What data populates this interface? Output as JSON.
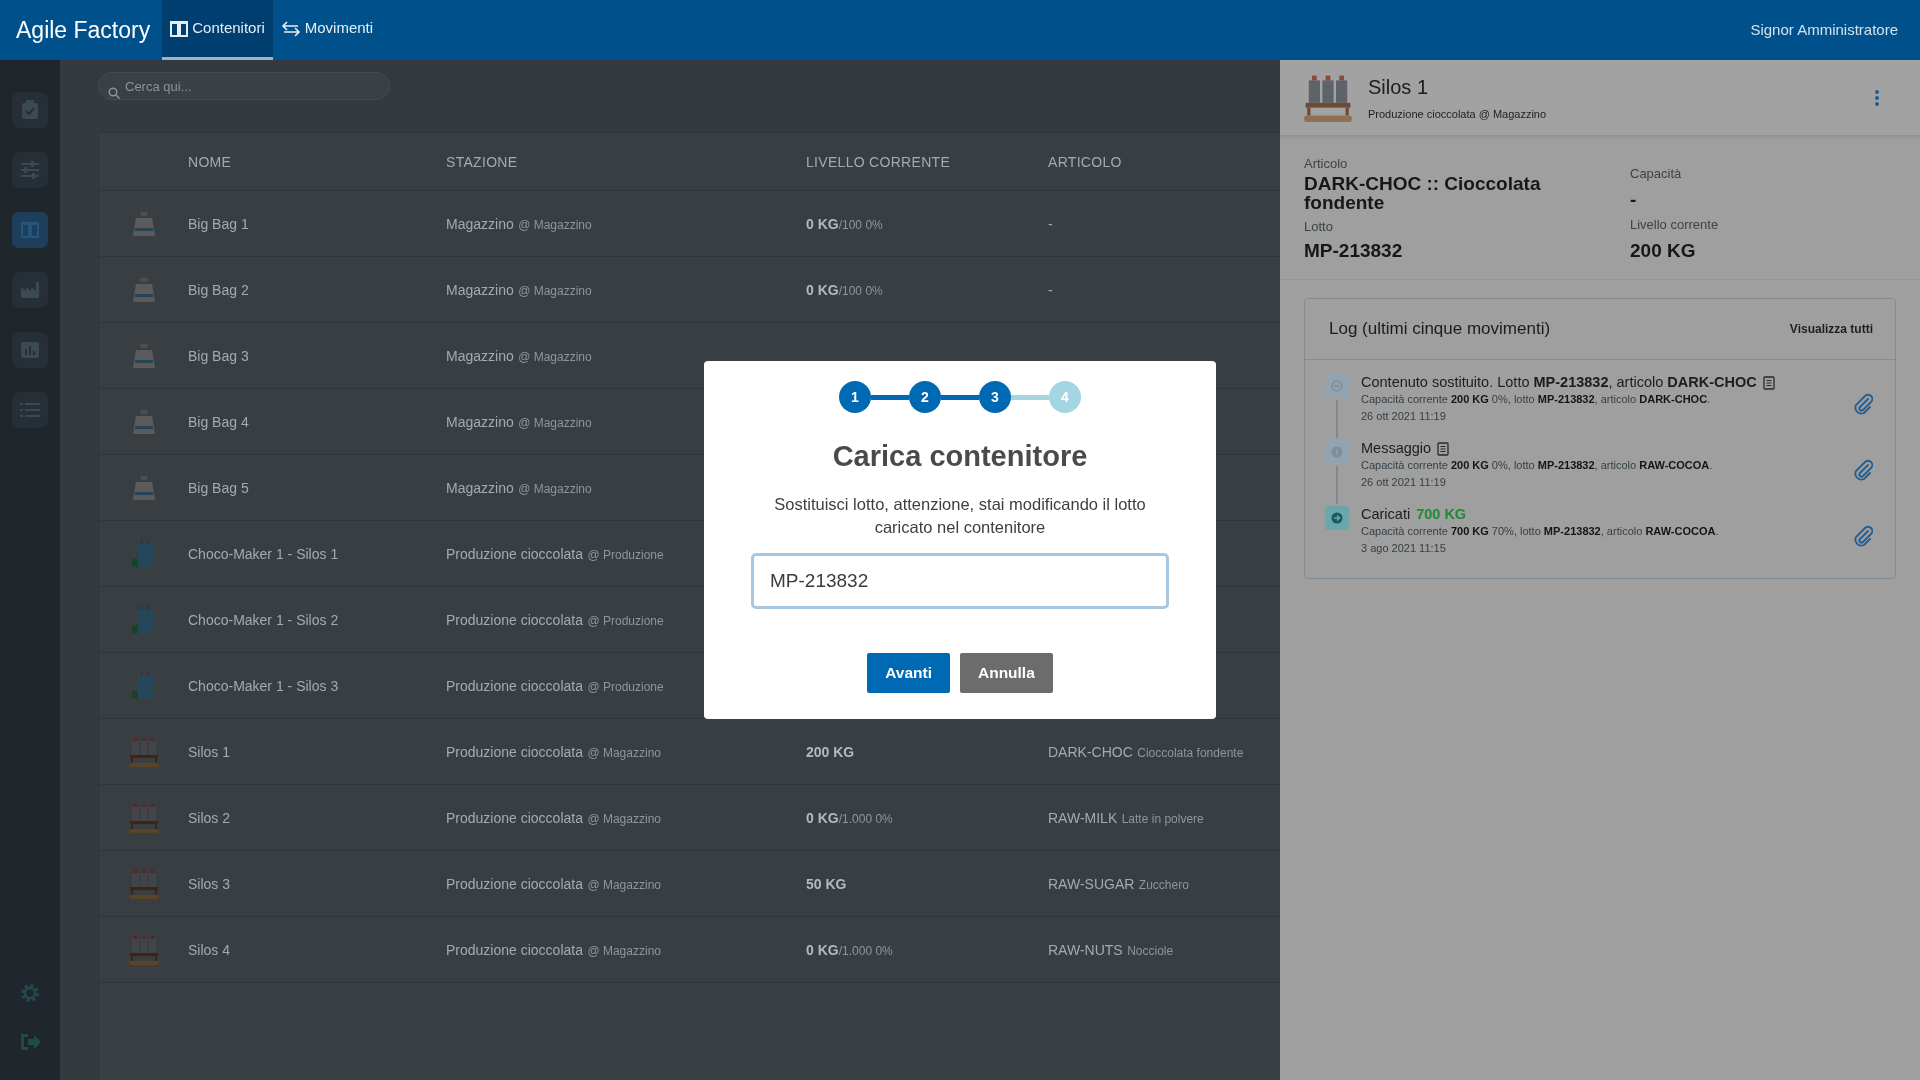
{
  "app": {
    "title": "Agile Factory",
    "user": "Signor Amministratore"
  },
  "nav_tabs": [
    {
      "label": "Contenitori",
      "kind": "containers",
      "selected": true
    },
    {
      "label": "Movimenti",
      "kind": "transfers",
      "selected": false
    }
  ],
  "sidebar": {
    "items": [
      {
        "kind": "tasks",
        "selected": false
      },
      {
        "kind": "flows",
        "selected": false
      },
      {
        "kind": "containers",
        "selected": true
      },
      {
        "kind": "factory",
        "selected": false
      },
      {
        "kind": "chart",
        "selected": false
      },
      {
        "kind": "list",
        "selected": false
      }
    ]
  },
  "search": {
    "placeholder": "Cerca qui..."
  },
  "table": {
    "columns": [
      "NOME",
      "STAZIONE",
      "LIVELLO CORRENTE",
      "ARTICOLO"
    ],
    "rows": [
      {
        "kind": "bigbag",
        "name": "Big Bag 1",
        "station": "Magazzino",
        "location": "@ Magazzino",
        "reading": "**0 KG**/100 0%",
        "article_code": "-"
      },
      {
        "kind": "bigbag",
        "name": "Big Bag 2",
        "station": "Magazzino",
        "location": "@ Magazzino",
        "reading": "**0 KG**/100 0%",
        "article_code": "-"
      },
      {
        "kind": "bigbag",
        "name": "Big Bag 3",
        "station": "Magazzino",
        "location": "@ Magazzino"
      },
      {
        "kind": "bigbag",
        "name": "Big Bag 4",
        "station": "Magazzino",
        "location": "@ Magazzino"
      },
      {
        "kind": "bigbag",
        "name": "Big Bag 5",
        "station": "Magazzino",
        "location": "@ Magazzino"
      },
      {
        "kind": "tank",
        "name": "Choco-Maker 1 - Silos 1",
        "station": "Produzione cioccolata",
        "location": "@ Produzione"
      },
      {
        "kind": "tank",
        "name": "Choco-Maker 1 - Silos 2",
        "station": "Produzione cioccolata",
        "location": "@ Produzione"
      },
      {
        "kind": "tank",
        "name": "Choco-Maker 1 - Silos 3",
        "station": "Produzione cioccolata",
        "location": "@ Produzione"
      },
      {
        "kind": "silos",
        "name": "Silos 1",
        "station": "Produzione cioccolata",
        "location": "@ Magazzino",
        "reading": "**200 KG**",
        "article_code": "DARK-CHOC",
        "article_name": "Cioccolata fondente"
      },
      {
        "kind": "silos",
        "name": "Silos 2",
        "station": "Produzione cioccolata",
        "location": "@ Magazzino",
        "reading": "**0 KG**/1.000 0%",
        "article_code": "RAW-MILK",
        "article_name": "Latte in polvere"
      },
      {
        "kind": "silos",
        "name": "Silos 3",
        "station": "Produzione cioccolata",
        "location": "@ Magazzino",
        "reading": "**50 KG**",
        "article_code": "RAW-SUGAR",
        "article_name": "Zucchero"
      },
      {
        "kind": "silos",
        "name": "Silos 4",
        "station": "Produzione cioccolata",
        "location": "@ Magazzino",
        "reading": "**0 KG**/1.000 0%",
        "article_code": "RAW-NUTS",
        "article_name": "Nocciole"
      }
    ]
  },
  "detail": {
    "title": "Silos 1",
    "subtitle": "Produzione cioccolata @ Magazzino",
    "article_label": "Articolo",
    "article": "DARK-CHOC :: Cioccolata fondente",
    "lot_label": "Lotto",
    "lot": "MP-213832",
    "capacity_label": "Capacità",
    "capacity": "-",
    "current_label": "Livello corrente",
    "current": "200 KG",
    "log": {
      "title": "Log (ultimi cinque movimenti)",
      "link": "Visualizza tutti",
      "entries": [
        {
          "kind": "replace",
          "title": "Contenuto sostituito. Lotto **MP-213832**, articolo **DARK-CHOC**",
          "note": true,
          "detail": "Capacità corrente **200 KG** 0%, lotto **MP-213832**, articolo **DARK-CHOC**.",
          "date": "26 ott 2021 11:19"
        },
        {
          "kind": "message",
          "title": "Messaggio",
          "note": true,
          "detail": "Capacità corrente **200 KG** 0%, lotto **MP-213832**, articolo **RAW-COCOA**.",
          "date": "26 ott 2021 11:19"
        },
        {
          "kind": "load",
          "title": "Caricati",
          "amount": "700 KG",
          "note": false,
          "detail": "Capacità corrente **700 KG** 70%, lotto **MP-213832**, articolo **RAW-COCOA**.",
          "date": "3 ago 2021 11:15"
        }
      ]
    }
  },
  "modal": {
    "steps": [
      {
        "label": "1",
        "done": true
      },
      {
        "label": "2",
        "done": true
      },
      {
        "label": "3",
        "done": true
      },
      {
        "label": "4",
        "done": false
      }
    ],
    "title": "Carica contenitore",
    "message": "Sostituisci lotto, attenzione, stai modificando il lotto caricato nel contenitore",
    "value": "MP-213832",
    "buttons": [
      {
        "label": "Avanti",
        "kind": "primary"
      },
      {
        "label": "Annulla",
        "kind": "secondary"
      }
    ]
  }
}
